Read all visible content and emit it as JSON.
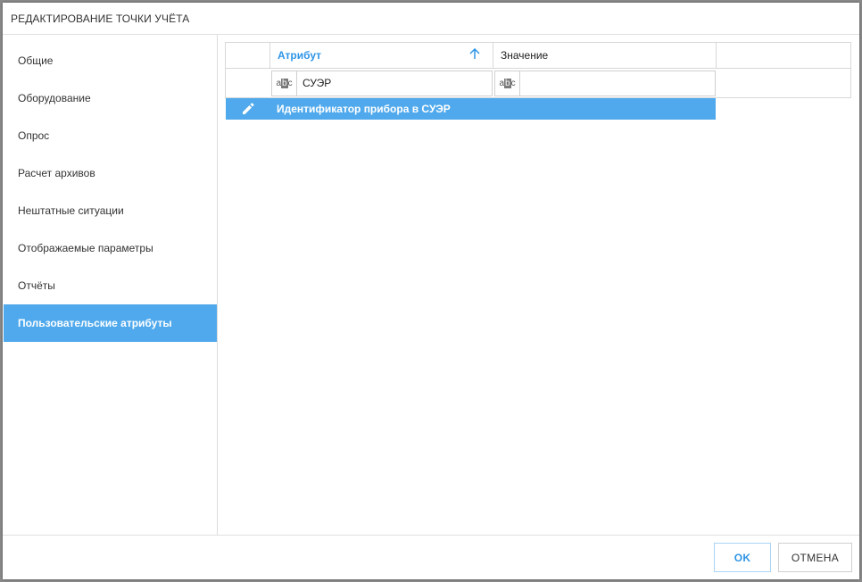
{
  "dialog": {
    "title": "РЕДАКТИРОВАНИЕ ТОЧКИ УЧЁТА"
  },
  "sidebar": {
    "items": [
      {
        "label": "Общие"
      },
      {
        "label": "Оборудование"
      },
      {
        "label": "Опрос"
      },
      {
        "label": "Расчет архивов"
      },
      {
        "label": "Нештатные ситуации"
      },
      {
        "label": "Отображаемые параметры"
      },
      {
        "label": "Отчёты"
      },
      {
        "label": "Пользовательские атрибуты",
        "active": true
      }
    ]
  },
  "grid": {
    "columns": [
      {
        "label": "Атрибут",
        "sorted": "ascending"
      },
      {
        "label": "Значение"
      }
    ],
    "filters": {
      "attribute_value": "СУЭР",
      "value_value": "",
      "filter_icon": "abc-icon"
    },
    "rows": [
      {
        "attribute": "Идентификатор прибора в СУЭР",
        "value": "",
        "icon": "pencil-icon",
        "selected": true
      }
    ]
  },
  "footer": {
    "ok_label": "OK",
    "cancel_label": "ОТМЕНА"
  },
  "colors": {
    "accent": "#4fa9ec",
    "accent_text": "#2f95e6"
  }
}
